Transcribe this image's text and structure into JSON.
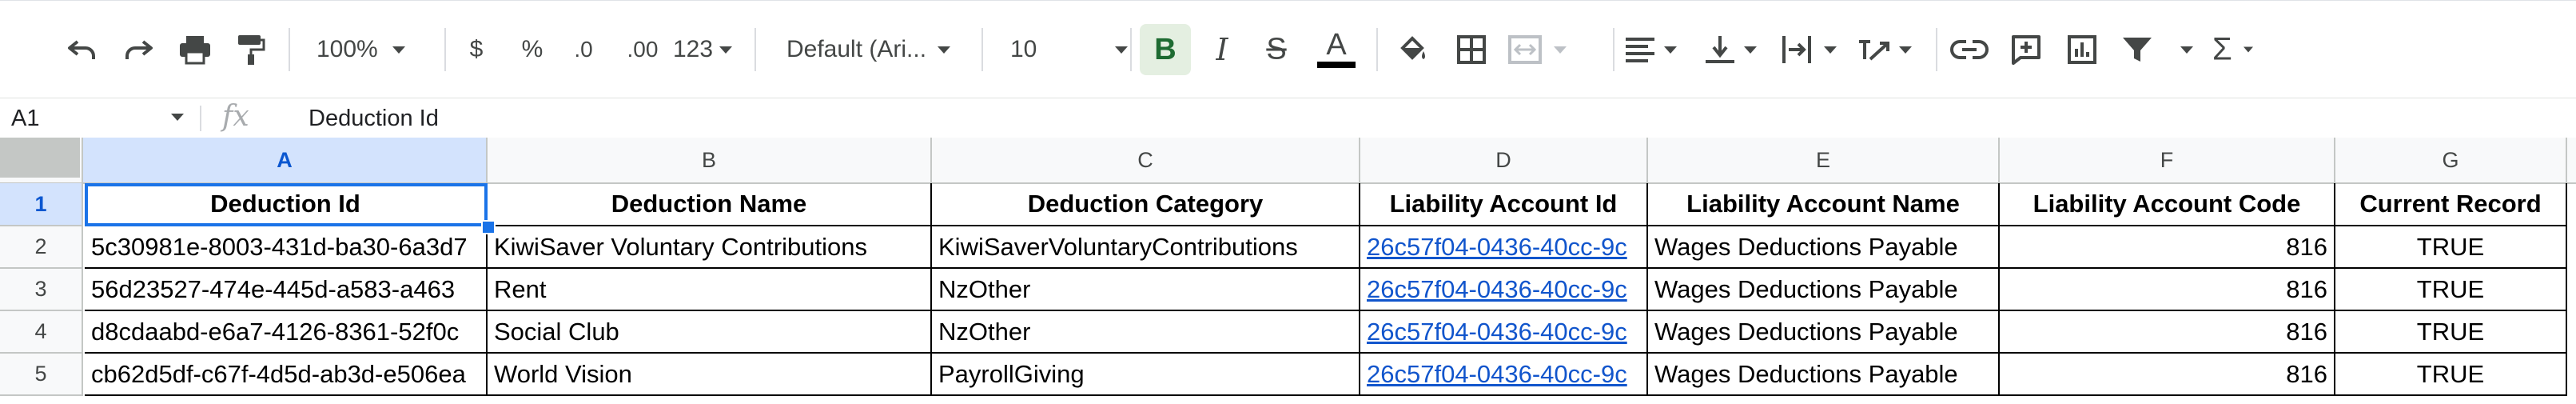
{
  "toolbar": {
    "zoom": "100%",
    "currency": "$",
    "percent": "%",
    "decrease_decimal": ".0",
    "increase_decimal": ".00",
    "more_formats": "123",
    "font": "Default (Ari...",
    "font_size": "10",
    "bold_glyph": "B",
    "italic_glyph": "I",
    "strike_glyph": "S",
    "textcolor_glyph": "A",
    "sum_glyph": "Σ"
  },
  "formula_bar": {
    "name_box": "A1",
    "fx": "fx",
    "content": "Deduction Id"
  },
  "columns": [
    "A",
    "B",
    "C",
    "D",
    "E",
    "F",
    "G"
  ],
  "rows": [
    "1",
    "2",
    "3",
    "4",
    "5"
  ],
  "table": {
    "headers": [
      "Deduction Id",
      "Deduction Name",
      "Deduction Category",
      "Liability Account Id",
      "Liability Account Name",
      "Liability Account Code",
      "Current Record"
    ],
    "data": [
      [
        "5c30981e-8003-431d-ba30-6a3d7",
        "KiwiSaver Voluntary Contributions",
        "KiwiSaverVoluntaryContributions",
        "26c57f04-0436-40cc-9c",
        "Wages Deductions Payable",
        "816",
        "TRUE"
      ],
      [
        "56d23527-474e-445d-a583-a463",
        "Rent",
        "NzOther",
        "26c57f04-0436-40cc-9c",
        "Wages Deductions Payable",
        "816",
        "TRUE"
      ],
      [
        "d8cdaabd-e6a7-4126-8361-52f0c",
        "Social Club",
        "NzOther",
        "26c57f04-0436-40cc-9c",
        "Wages Deductions Payable",
        "816",
        "TRUE"
      ],
      [
        "cb62d5df-c67f-4d5d-ab3d-e506ea",
        "World Vision",
        "PayrollGiving",
        "26c57f04-0436-40cc-9c",
        "Wages Deductions Payable",
        "816",
        "TRUE"
      ]
    ]
  },
  "colors": {
    "selection": "#1a73e8",
    "link": "#1155cc",
    "bold_active_bg": "#e4efe1",
    "header_bg": "#f8f9fa"
  }
}
